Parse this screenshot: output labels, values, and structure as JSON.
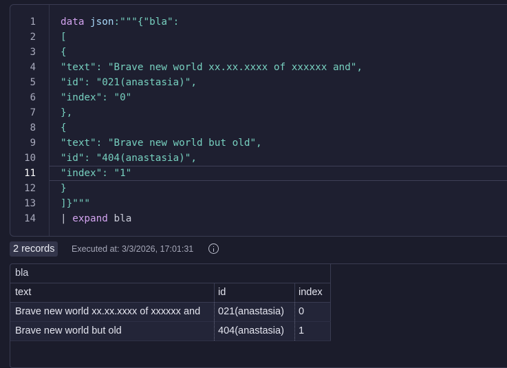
{
  "editor": {
    "active_line": 11,
    "lines": [
      {
        "n": "1",
        "tokens": [
          {
            "t": "data",
            "c": "kw"
          },
          {
            "t": " ",
            "c": "punct"
          },
          {
            "t": "json",
            "c": "ident"
          },
          {
            "t": ":\"\"\"",
            "c": "str"
          },
          {
            "t": "{\"bla\":",
            "c": "str"
          }
        ]
      },
      {
        "n": "2",
        "tokens": [
          {
            "t": "[",
            "c": "str"
          }
        ]
      },
      {
        "n": "3",
        "tokens": [
          {
            "t": "{",
            "c": "str"
          }
        ]
      },
      {
        "n": "4",
        "tokens": [
          {
            "t": "\"text\": \"Brave new world xx.xx.xxxx of xxxxxx and\",",
            "c": "str"
          }
        ]
      },
      {
        "n": "5",
        "tokens": [
          {
            "t": "\"id\": \"021(anastasia)\",",
            "c": "str"
          }
        ]
      },
      {
        "n": "6",
        "tokens": [
          {
            "t": "\"index\": \"0\"",
            "c": "str"
          }
        ]
      },
      {
        "n": "7",
        "tokens": [
          {
            "t": "},",
            "c": "str"
          }
        ]
      },
      {
        "n": "8",
        "tokens": [
          {
            "t": "{",
            "c": "str"
          }
        ]
      },
      {
        "n": "9",
        "tokens": [
          {
            "t": "\"text\": \"Brave new world but old\",",
            "c": "str"
          }
        ]
      },
      {
        "n": "10",
        "tokens": [
          {
            "t": "\"id\": \"404(anastasia)\",",
            "c": "str"
          }
        ]
      },
      {
        "n": "11",
        "tokens": [
          {
            "t": "\"index\": \"1\"",
            "c": "str"
          }
        ]
      },
      {
        "n": "12",
        "tokens": [
          {
            "t": "}",
            "c": "str"
          }
        ]
      },
      {
        "n": "13",
        "tokens": [
          {
            "t": "]}\"\"\"",
            "c": "str"
          }
        ]
      },
      {
        "n": "14",
        "tokens": [
          {
            "t": "| ",
            "c": "pipe"
          },
          {
            "t": "expand",
            "c": "kw"
          },
          {
            "t": " bla",
            "c": "punct"
          }
        ]
      }
    ]
  },
  "status": {
    "records": "2 records",
    "executed": "Executed at: 3/3/2026, 17:01:31",
    "info_icon": "info-icon"
  },
  "results": {
    "group": "bla",
    "columns": [
      "text",
      "id",
      "index"
    ],
    "rows": [
      [
        "Brave new world xx.xx.xxxx of xxxxxx and",
        "021(anastasia)",
        "0"
      ],
      [
        "Brave new world but old",
        "404(anastasia)",
        "1"
      ]
    ]
  }
}
